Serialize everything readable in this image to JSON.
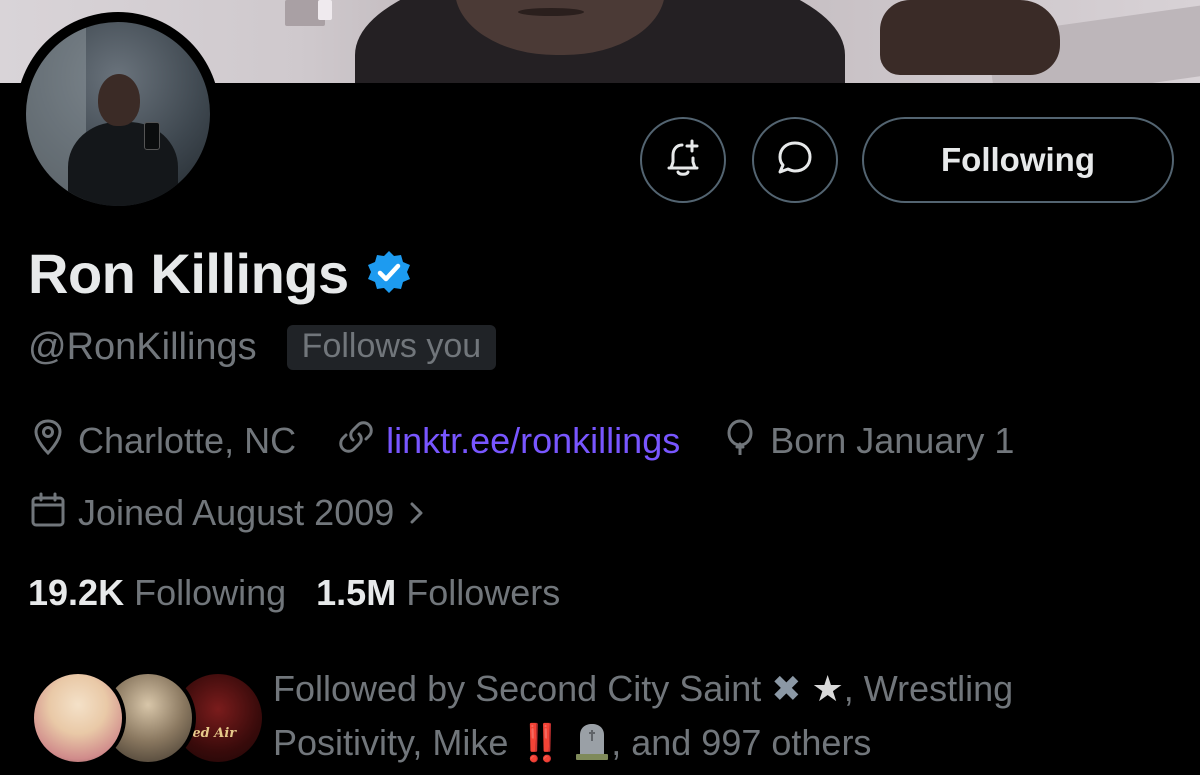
{
  "profile": {
    "display_name": "Ron Killings",
    "handle": "@RonKillings",
    "follows_you_badge": "Follows you",
    "verified": true,
    "verified_color": "#1d9bf0"
  },
  "actions": {
    "notify_icon": "bell-plus-icon",
    "message_icon": "message-bubble-icon",
    "following_label": "Following"
  },
  "meta": {
    "location": "Charlotte, NC",
    "link": "linktr.ee/ronkillings",
    "link_color": "#7856ff",
    "birthday": "Born January 1",
    "joined": "Joined August 2009"
  },
  "counts": {
    "following_num": "19.2K",
    "following_label": "Following",
    "followers_num": "1.5M",
    "followers_label": "Followers"
  },
  "followed_by": {
    "prefix": "Followed by Second City Saint",
    "x_emoji": "✖",
    "star_emoji": "★",
    "mid": ", Wrestling",
    "line2_start": "Positivity, Mike",
    "bang_emoji": "‼️",
    "suffix": ", and 997 others",
    "avatar3_text": "ified Air"
  },
  "colors": {
    "background": "#000000",
    "primary_text": "#e7e9ea",
    "secondary_text": "#71767b",
    "border": "#536471"
  }
}
